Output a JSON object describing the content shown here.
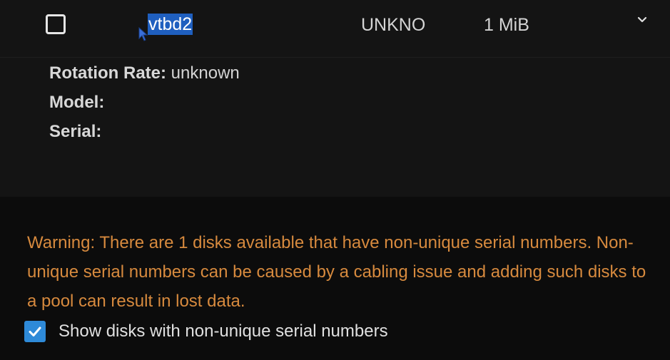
{
  "disk": {
    "name": "vtbd2",
    "type": "UNKNO",
    "size": "1 MiB",
    "selected": false,
    "expanded": true,
    "details": {
      "rotation_label": "Rotation Rate:",
      "rotation_value": "unknown",
      "model_label": "Model:",
      "model_value": "",
      "serial_label": "Serial:",
      "serial_value": ""
    }
  },
  "warning": {
    "text": "Warning: There are 1 disks available that have non-unique serial numbers. Non-unique serial numbers can be caused by a cabling issue and adding such disks to a pool can result in lost data.",
    "color": "#d78a3e"
  },
  "show_non_unique": {
    "label": "Show disks with non-unique serial numbers",
    "checked": true
  },
  "colors": {
    "accent": "#2e8ad8",
    "selection": "#1f5fbf"
  },
  "icons": {
    "expand": "chevron-down-icon",
    "checkmark": "checkmark-icon",
    "cursor": "mouse-cursor-icon"
  }
}
